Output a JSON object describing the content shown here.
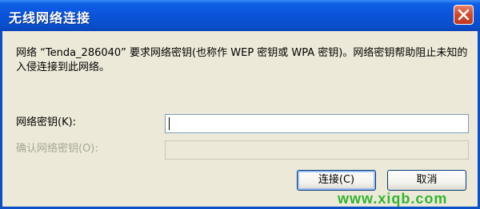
{
  "window": {
    "title": "无线网络连接",
    "close_icon": "close-icon",
    "colors": {
      "titlebar": "#0a53d8",
      "dialog_bg": "#ece9d8",
      "close_bg": "#d6492b"
    }
  },
  "prompt": {
    "text": "网络 “Tenda_286040” 要求网络密钥(也称作 WEP 密钥或 WPA 密钥)。网络密钥帮助阻止未知的入侵连接到此网络。"
  },
  "fields": {
    "network_key_label": "网络密钥(K):",
    "network_key_value": "",
    "confirm_key_label": "确认网络密钥(O):",
    "confirm_key_value": ""
  },
  "buttons": {
    "connect_label": "连接(C)",
    "cancel_label": "取消"
  },
  "watermark": {
    "text": "www.xiqb.com"
  }
}
